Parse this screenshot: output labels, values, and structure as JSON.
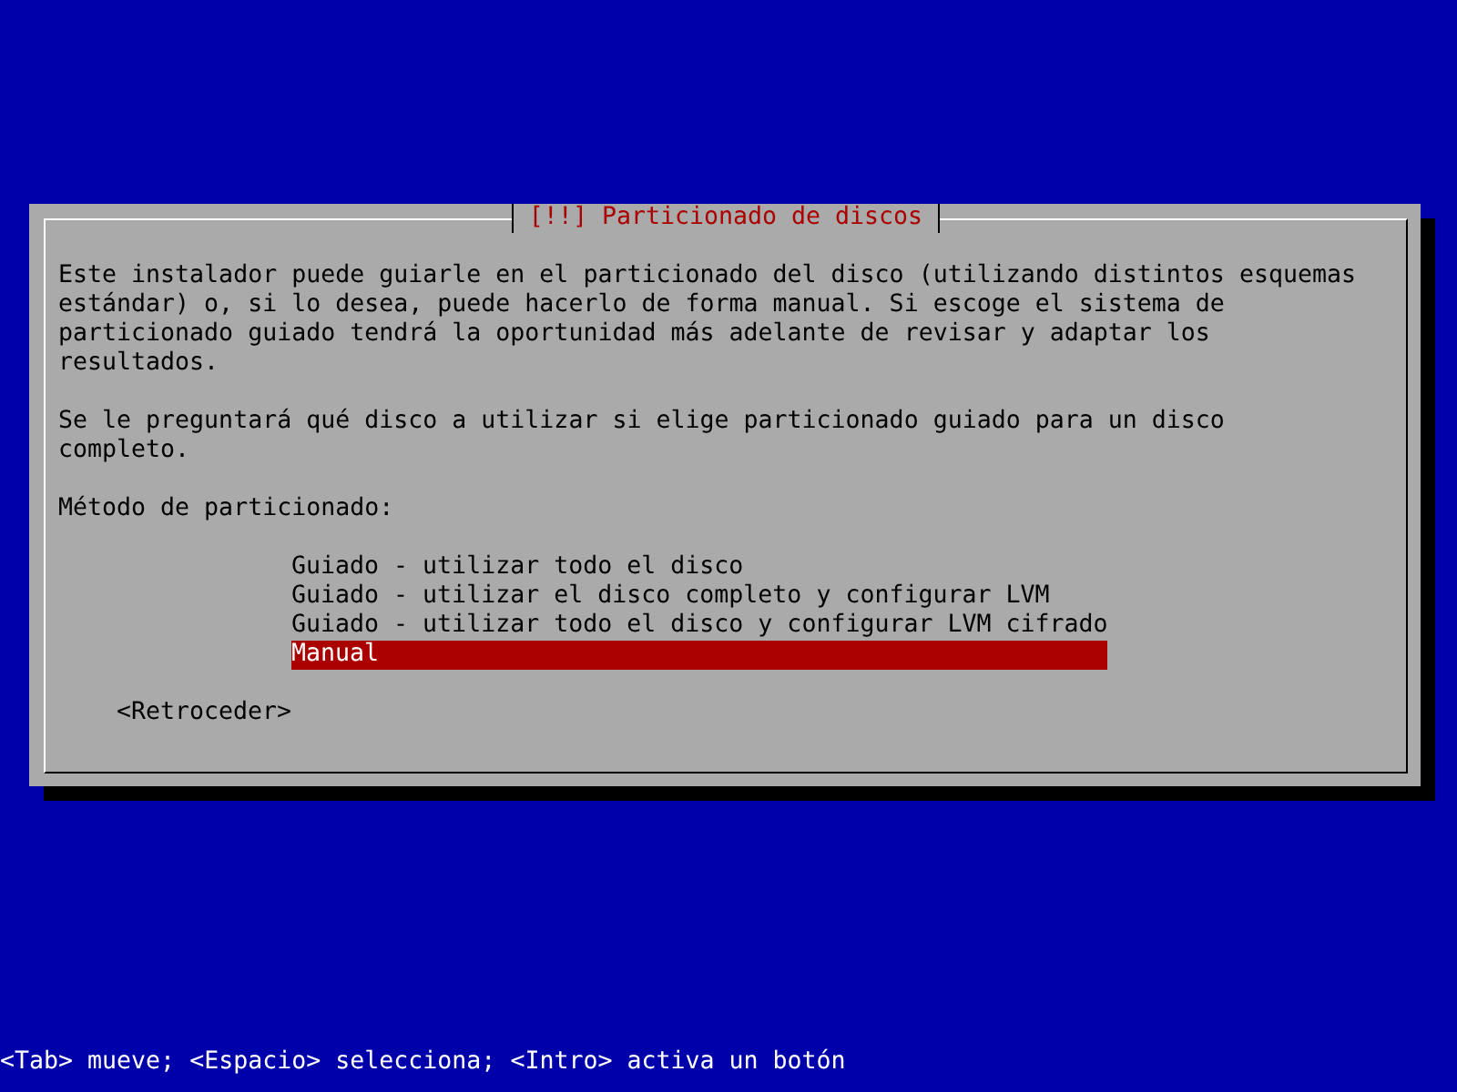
{
  "dialog": {
    "title": "[!!] Particionado de discos",
    "paragraphs": [
      "Este instalador puede guiarle en el particionado del disco (utilizando distintos esquemas\nestándar) o, si lo desea, puede hacerlo de forma manual. Si escoge el sistema de\nparticionado guiado tendrá la oportunidad más adelante de revisar y adaptar los\nresultados.",
      "Se le preguntará qué disco a utilizar si elige particionado guiado para un disco\ncompleto.",
      "Método de particionado:"
    ],
    "options": [
      {
        "label": "Guiado - utilizar todo el disco",
        "selected": false
      },
      {
        "label": "Guiado - utilizar el disco completo y configurar LVM",
        "selected": false
      },
      {
        "label": "Guiado - utilizar todo el disco y configurar LVM cifrado",
        "selected": false
      },
      {
        "label": "Manual",
        "selected": true
      }
    ],
    "buttons": [
      {
        "label": "<Retroceder>",
        "selected": false
      }
    ]
  },
  "help_line": "<Tab> mueve; <Espacio> selecciona; <Intro> activa un botón"
}
